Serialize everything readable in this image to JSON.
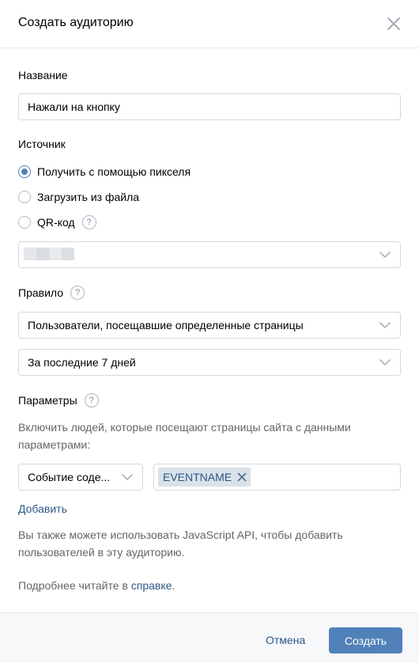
{
  "header": {
    "title": "Создать аудиторию",
    "close_icon": "close-icon"
  },
  "name_field": {
    "label": "Название",
    "value": "Нажали на кнопку"
  },
  "source": {
    "label": "Источник",
    "options": [
      {
        "label": "Получить с помощью пикселя",
        "checked": true
      },
      {
        "label": "Загрузить из файла",
        "checked": false
      },
      {
        "label": "QR-код",
        "checked": false,
        "help_icon": "question-icon"
      }
    ],
    "pixel_select_value": ""
  },
  "rule": {
    "label": "Правило",
    "help_icon": "question-icon",
    "select_value": "Пользователи, посещавшие определенные страницы",
    "period_value": "За последние 7 дней"
  },
  "params": {
    "label": "Параметры",
    "help_icon": "question-icon",
    "hint": "Включить людей, которые посещают страницы сайта с данными параметрами:",
    "event_select_value": "Событие соде...",
    "tags": [
      "EVENTNAME"
    ],
    "add_link": "Добавить"
  },
  "info": {
    "api_text": "Вы также можете использовать JavaScript API, чтобы добавить пользователей в эту аудиторию.",
    "more_prefix": "Подробнее читайте в ",
    "more_link": "справке",
    "more_suffix": "."
  },
  "footer": {
    "cancel_label": "Отмена",
    "create_label": "Создать"
  },
  "colors": {
    "accent": "#5181b8",
    "link": "#2a5885",
    "border": "#d3d9de",
    "tag_bg": "#dae2ea",
    "footer_bg": "#f7f8fa"
  }
}
